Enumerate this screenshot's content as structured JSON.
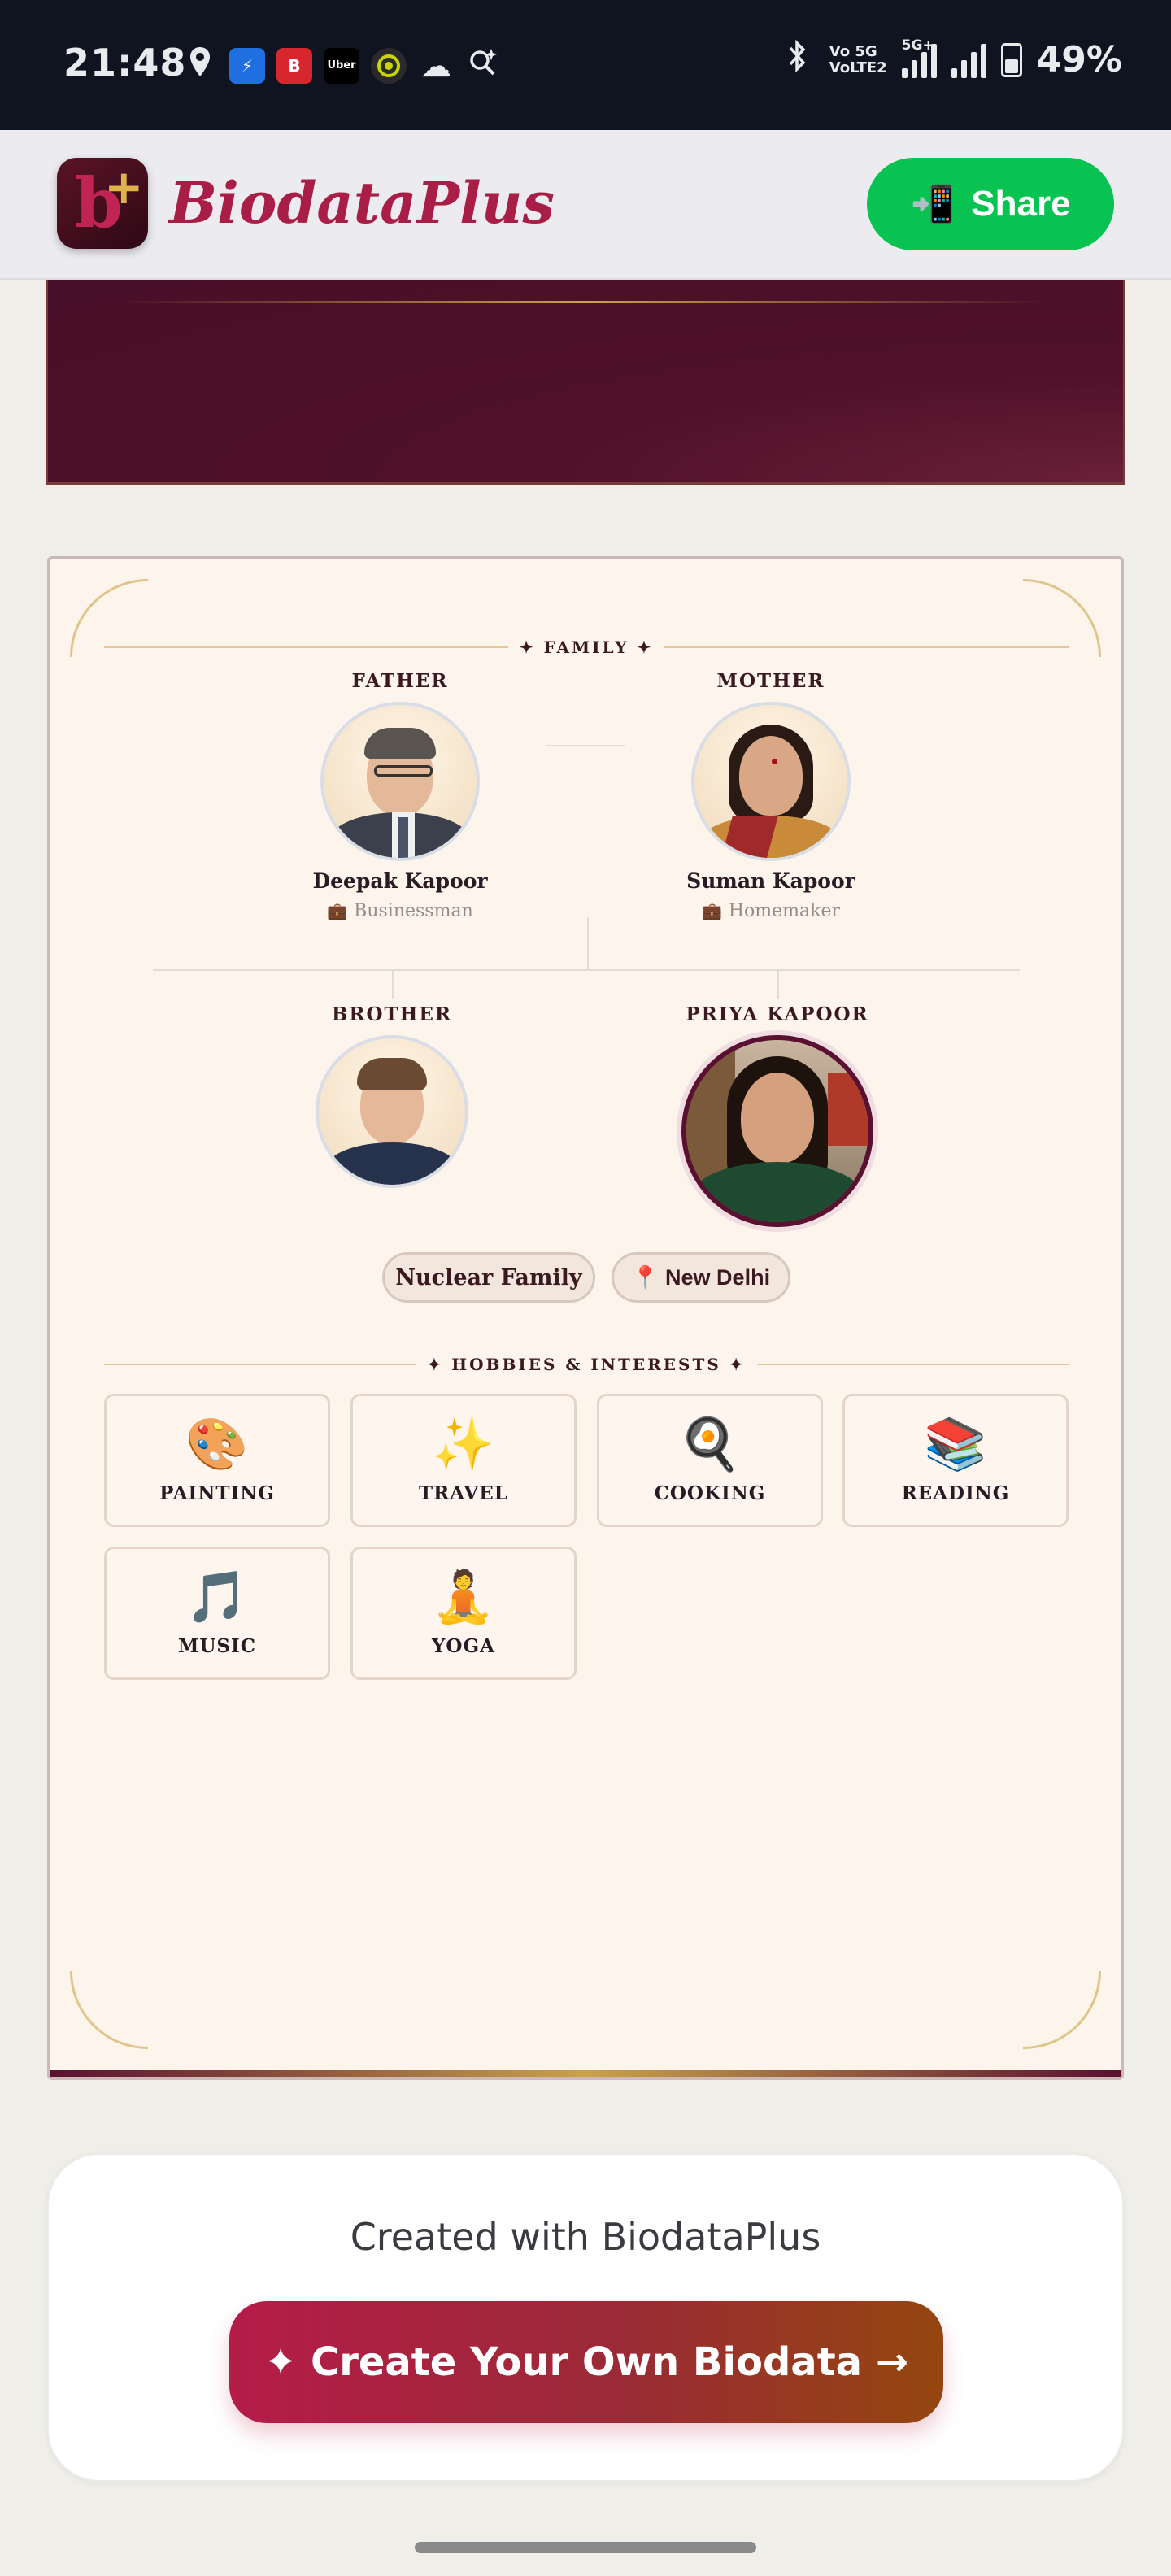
{
  "status_bar": {
    "time": "21:48",
    "network_top": "Vo 5G",
    "network_bottom": "VoLTE2",
    "five_g": "5G+",
    "battery": "49%",
    "left_icons": [
      "location-icon",
      "app-k-icon",
      "app-b-icon",
      "uber-icon",
      "circle-app-icon",
      "cloud-icon",
      "search-sparkle-icon"
    ],
    "uber_label": "Uber"
  },
  "header": {
    "logo_letter": "b",
    "logo_plus": "+",
    "brand": "BiodataPlus",
    "share_label": "Share",
    "share_icon": "phone-share-icon",
    "brand_color": "#a81e46",
    "share_color": "#08c351"
  },
  "family": {
    "section_title": "✦ FAMILY ✦",
    "father": {
      "role": "FATHER",
      "name": "Deepak Kapoor",
      "occupation": "Businessman"
    },
    "mother": {
      "role": "MOTHER",
      "name": "Suman Kapoor",
      "occupation": "Homemaker"
    },
    "brother": {
      "role": "BROTHER"
    },
    "self": {
      "role": "PRIYA KAPOOR"
    },
    "tags": [
      {
        "label": "Nuclear Family"
      },
      {
        "label": "📍 New Delhi"
      }
    ]
  },
  "hobbies": {
    "section_title": "✦ HOBBIES & INTERESTS ✦",
    "items": [
      {
        "emoji": "🎨",
        "label": "PAINTING"
      },
      {
        "emoji": "✨",
        "label": "TRAVEL"
      },
      {
        "emoji": "🍳",
        "label": "COOKING"
      },
      {
        "emoji": "📚",
        "label": "READING"
      },
      {
        "emoji": "🎵",
        "label": "MUSIC"
      },
      {
        "emoji": "🧘",
        "label": "YOGA"
      }
    ]
  },
  "footer": {
    "created_with": "Created with BiodataPlus",
    "cta_label": "✦ Create Your Own Biodata →"
  },
  "colors": {
    "maroon": "#4a0f28",
    "gold": "#c9a24a",
    "cream": "#fdf4ec",
    "cta_start": "#b51c48",
    "cta_end": "#94460e"
  }
}
